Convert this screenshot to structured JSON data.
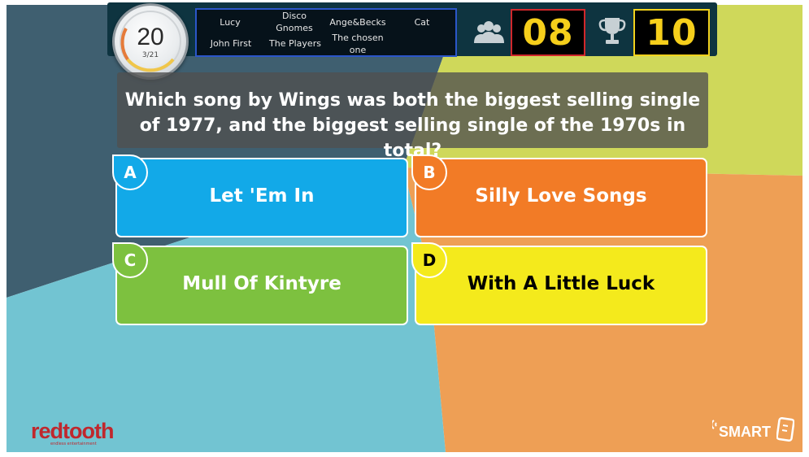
{
  "timer": {
    "seconds": "20",
    "progress": "3/21"
  },
  "teams": {
    "row1": [
      "Lucy",
      "Disco Gnomes",
      "Ange&Becks",
      "Cat"
    ],
    "row2": [
      "John First",
      "The Players",
      "The chosen one"
    ]
  },
  "scoreboard": {
    "players_icon": "people-icon",
    "players_count": "08",
    "trophy_icon": "trophy-icon",
    "top_score": "10"
  },
  "question": {
    "text": "Which song by Wings was both the biggest selling single of 1977, and the biggest selling single of the 1970s in total?"
  },
  "answers": [
    {
      "letter": "A",
      "text": "Let 'Em In",
      "color": "#12a9e8",
      "text_color": "#ffffff"
    },
    {
      "letter": "B",
      "text": "Silly Love Songs",
      "color": "#f27b26",
      "text_color": "#ffffff"
    },
    {
      "letter": "C",
      "text": "Mull Of Kintyre",
      "color": "#7dc13f",
      "text_color": "#ffffff"
    },
    {
      "letter": "D",
      "text": "With A Little Luck",
      "color": "#f4ea1c",
      "text_color": "#000000"
    }
  ],
  "branding": {
    "left_logo": "redtooth",
    "left_logo_sub": "endless entertainment",
    "right_logo": "SMART"
  },
  "colors": {
    "bg_dark": "#3f5f70",
    "bg_lime": "#cfd85a",
    "bg_cyan": "#72c4d2",
    "bg_orange": "#ee9f55"
  }
}
